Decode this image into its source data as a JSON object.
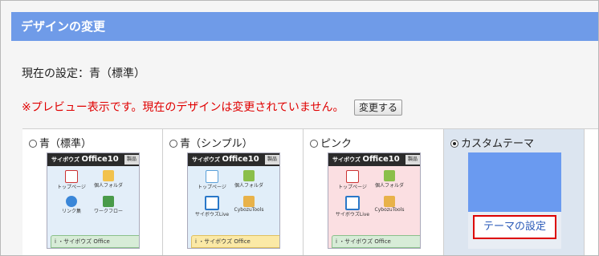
{
  "header": {
    "title": "デザインの変更"
  },
  "current": {
    "text": "現在の設定：青（標準）"
  },
  "notice": {
    "text": "※プレビュー表示です。現在のデザインは変更されていません。",
    "button_label": "変更する"
  },
  "themes": [
    {
      "label": "青（標準）",
      "selected": false,
      "palette": {
        "bg": "#d9e8f7",
        "icon_bg": "#ffffff",
        "bar": "#cfe6cf"
      }
    },
    {
      "label": "青（シンプル）",
      "selected": false,
      "palette": {
        "bg": "#dcebf7",
        "icon_bg": "#ffffff",
        "bar": "#fbe7a0"
      }
    },
    {
      "label": "ピンク",
      "selected": false,
      "palette": {
        "bg": "#fbd9dc",
        "icon_bg": "#ffffff",
        "bar": "#d8ead6"
      }
    },
    {
      "label": "カスタムテーマ",
      "selected": true,
      "button_label": "テーマの設定"
    }
  ],
  "thumbnail": {
    "logo_small": "サイボウズ",
    "logo_big": "Office10",
    "side_tab": "製品",
    "icons_a": [
      "トップページ",
      "個人フォルダ",
      "リンク集",
      "ワークフロー"
    ],
    "icons_b": [
      "トップページ",
      "個人フォルダ",
      "サイボウズLive",
      "CybozuTools"
    ],
    "info_text": "・サイボウズ Office",
    "info_icon": "i"
  }
}
